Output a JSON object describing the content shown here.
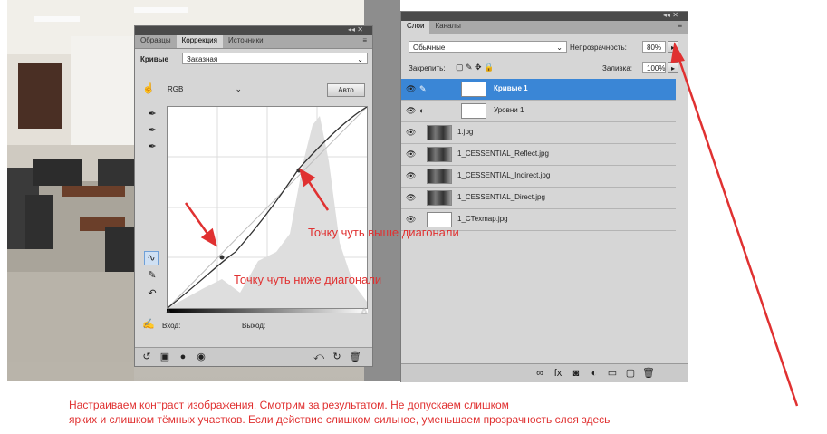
{
  "curves_panel": {
    "tabs": [
      "Образцы",
      "Коррекция",
      "Источники"
    ],
    "active_tab": "Коррекция",
    "preset_label": "Кривые",
    "preset_value": "Заказная",
    "channel_value": "RGB",
    "auto_button": "Авто",
    "input_label": "Вход:",
    "output_label": "Выход:"
  },
  "layers_panel": {
    "tabs": [
      "Слои",
      "Каналы"
    ],
    "blend_mode": "Обычные",
    "opacity_label": "Непрозрачность:",
    "opacity_value": "80%",
    "lock_label": "Закрепить:",
    "fill_label": "Заливка:",
    "fill_value": "100%",
    "layers": [
      {
        "name": "Кривые 1",
        "selected": true
      },
      {
        "name": "Уровни 1",
        "selected": false
      },
      {
        "name": "1.jpg",
        "selected": false
      },
      {
        "name": "1_CESSENTIAL_Reflect.jpg",
        "selected": false
      },
      {
        "name": "1_CESSENTIAL_Indirect.jpg",
        "selected": false
      },
      {
        "name": "1_CESSENTIAL_Direct.jpg",
        "selected": false
      },
      {
        "name": "1_CTexmap.jpg",
        "selected": false
      }
    ]
  },
  "annotations": {
    "above_diagonal": "Точку чуть выше диагонали",
    "below_diagonal": "Точку чуть ниже диагонали",
    "caption_line1": "Настраиваем контраст изображения. Смотрим за результатом. Не допускаем слишком",
    "caption_line2": "ярких и слишком тёмных участков. Если действие слишком сильное, уменьшаем прозрачность слоя здесь"
  },
  "colors": {
    "annotation": "#e03131",
    "selected_layer": "#3a86d6",
    "panel_bg": "#d6d6d6"
  }
}
